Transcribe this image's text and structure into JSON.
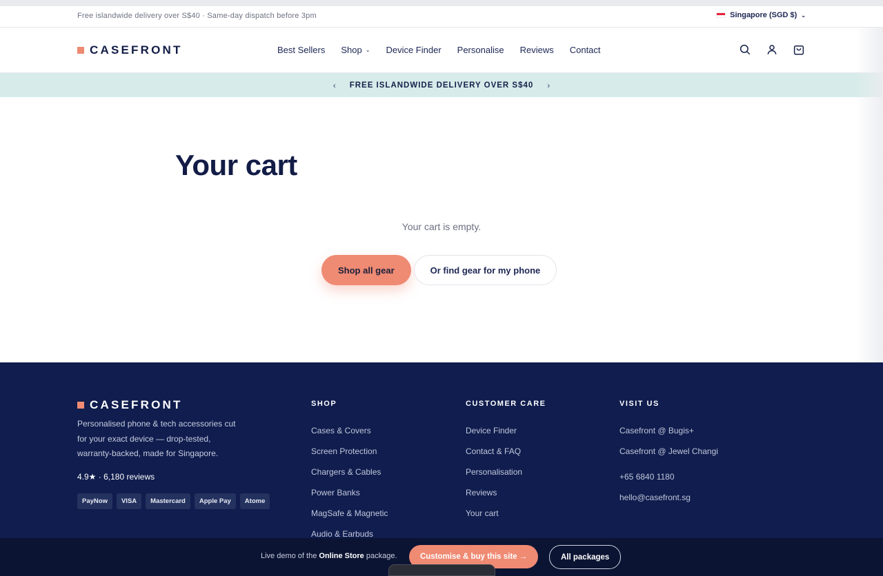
{
  "topbar": {
    "message": "Free islandwide delivery over S$40 · Same-day dispatch before 3pm",
    "region": "Singapore (SGD $)"
  },
  "header": {
    "logo": "CASEFRONT",
    "nav": [
      {
        "label": "Best Sellers"
      },
      {
        "label": "Shop"
      },
      {
        "label": "Device Finder"
      },
      {
        "label": "Personalise"
      },
      {
        "label": "Reviews"
      },
      {
        "label": "Contact"
      }
    ],
    "icons": [
      "search-icon",
      "account-icon",
      "cart-icon"
    ]
  },
  "promo": {
    "text": "FREE ISLANDWIDE DELIVERY OVER S$40",
    "prev": "‹",
    "next": "›"
  },
  "main": {
    "title": "Your cart",
    "empty_message": "Your cart is empty.",
    "primary_cta": "Shop all gear",
    "secondary_cta": "Or find gear for my phone"
  },
  "footer": {
    "logo": "CASEFRONT",
    "description": "Personalised phone & tech accessories cut for your exact device — drop-tested, warranty-backed, made for Singapore.",
    "rating": "4.9★ · 6,180 reviews",
    "payments": [
      "PayNow",
      "VISA",
      "Mastercard",
      "Apple Pay",
      "Atome"
    ],
    "columns": [
      {
        "title": "SHOP",
        "links": [
          "Cases & Covers",
          "Screen Protection",
          "Chargers & Cables",
          "Power Banks",
          "MagSafe & Magnetic",
          "Audio & Earbuds"
        ]
      },
      {
        "title": "CUSTOMER CARE",
        "links": [
          "Device Finder",
          "Contact & FAQ",
          "Personalisation",
          "Reviews",
          "Your cart"
        ]
      },
      {
        "title": "VISIT US",
        "links": [
          "Casefront @ Bugis+",
          "Casefront @ Jewel Changi",
          "+65 6840 1180",
          "hello@casefront.sg"
        ]
      }
    ]
  },
  "demo_bar": {
    "prefix": "Live demo of the ",
    "package": "Online Store",
    "suffix": " package.",
    "cta": "Customise & buy this site →",
    "all": "All packages"
  },
  "colors": {
    "navy": "#101d4e",
    "accent": "#ef8a73",
    "promo_bg": "#d7ecea"
  }
}
